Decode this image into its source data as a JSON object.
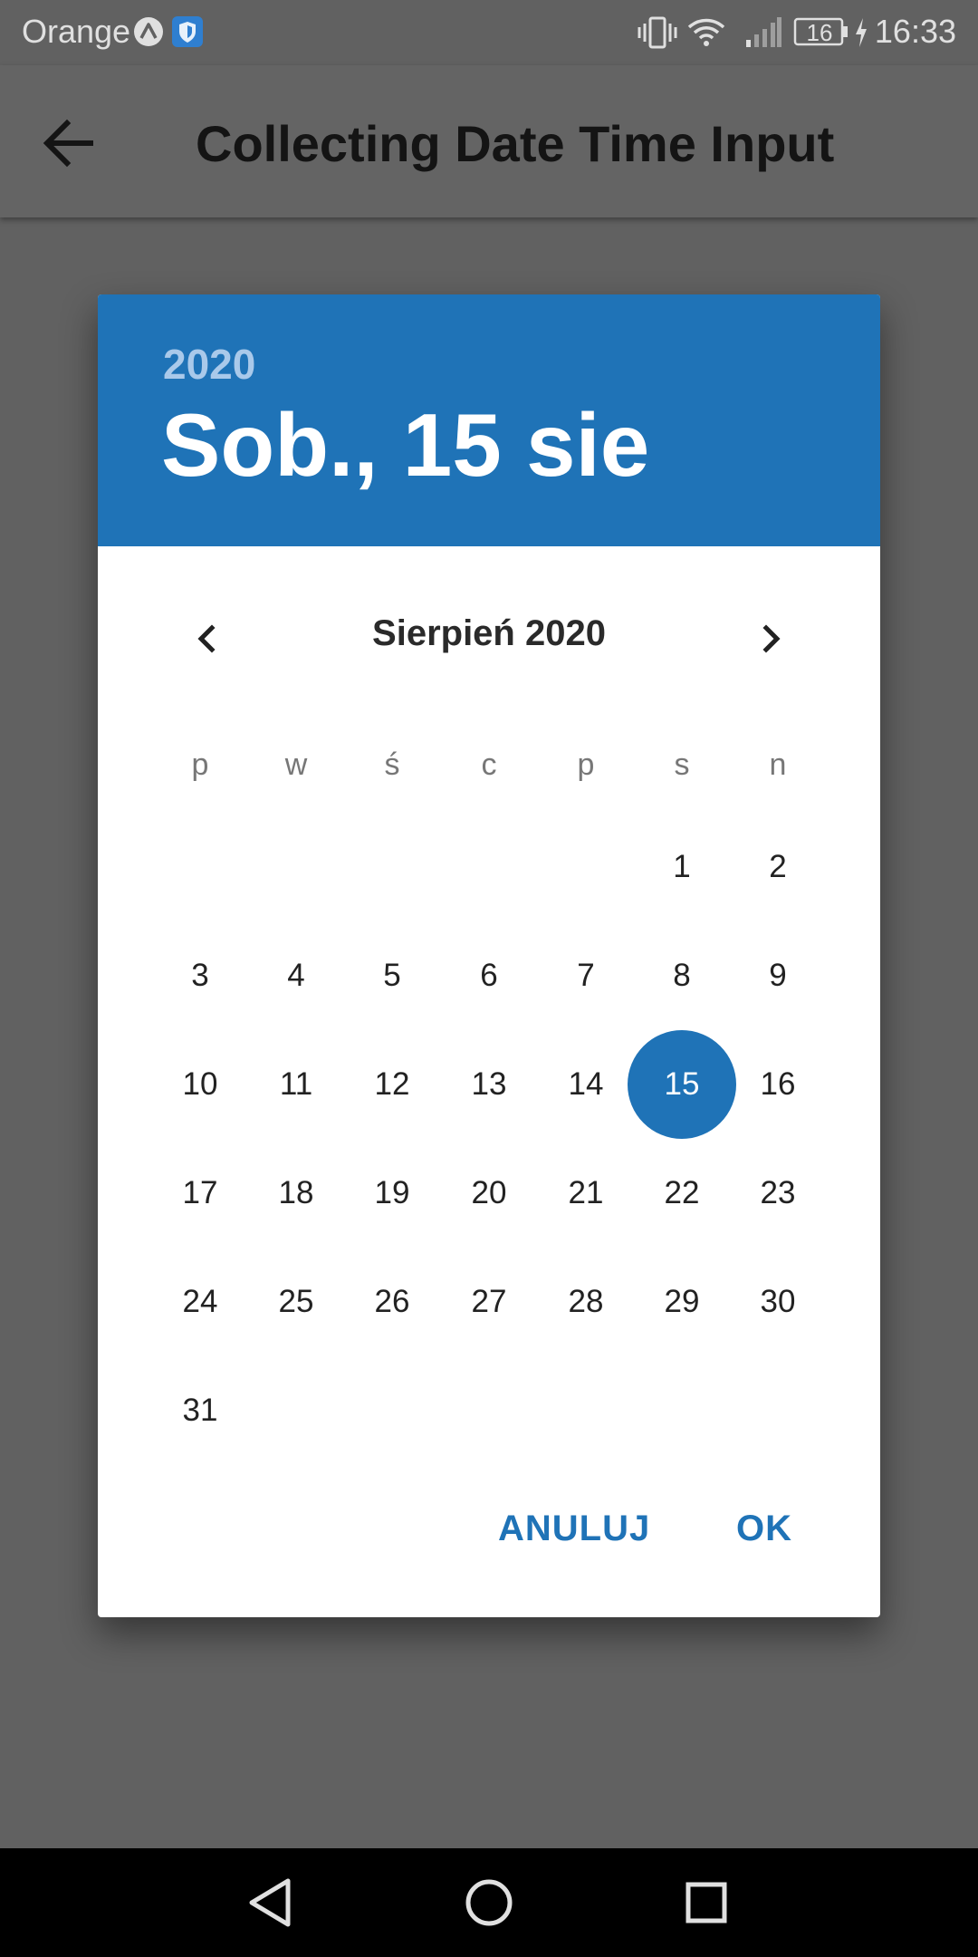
{
  "status_bar": {
    "carrier": "Orange",
    "battery": "16",
    "time": "16:33",
    "icons": [
      "expo-icon",
      "shield-icon",
      "vibrate-icon",
      "wifi-icon",
      "signal-icon",
      "battery-icon",
      "charging-icon"
    ]
  },
  "app_bar": {
    "title": "Collecting Date Time Input",
    "back_icon": "arrow-left-icon"
  },
  "dialog": {
    "header": {
      "year": "2020",
      "date": "Sob., 15 sie",
      "color": "#1f73b7"
    },
    "month_label": "Sierpień 2020",
    "prev_icon": "chevron-left-icon",
    "next_icon": "chevron-right-icon",
    "weekdays": [
      "p",
      "w",
      "ś",
      "c",
      "p",
      "s",
      "n"
    ],
    "days": [
      "1",
      "2",
      "3",
      "4",
      "5",
      "6",
      "7",
      "8",
      "9",
      "10",
      "11",
      "12",
      "13",
      "14",
      "15",
      "16",
      "17",
      "18",
      "19",
      "20",
      "21",
      "22",
      "23",
      "24",
      "25",
      "26",
      "27",
      "28",
      "29",
      "30",
      "31"
    ],
    "first_weekday_index": 5,
    "selected_day": "15",
    "cancel_label": "ANULUJ",
    "ok_label": "OK"
  },
  "nav_bar": {
    "icons": [
      "back-triangle-icon",
      "home-circle-icon",
      "recents-square-icon"
    ]
  }
}
